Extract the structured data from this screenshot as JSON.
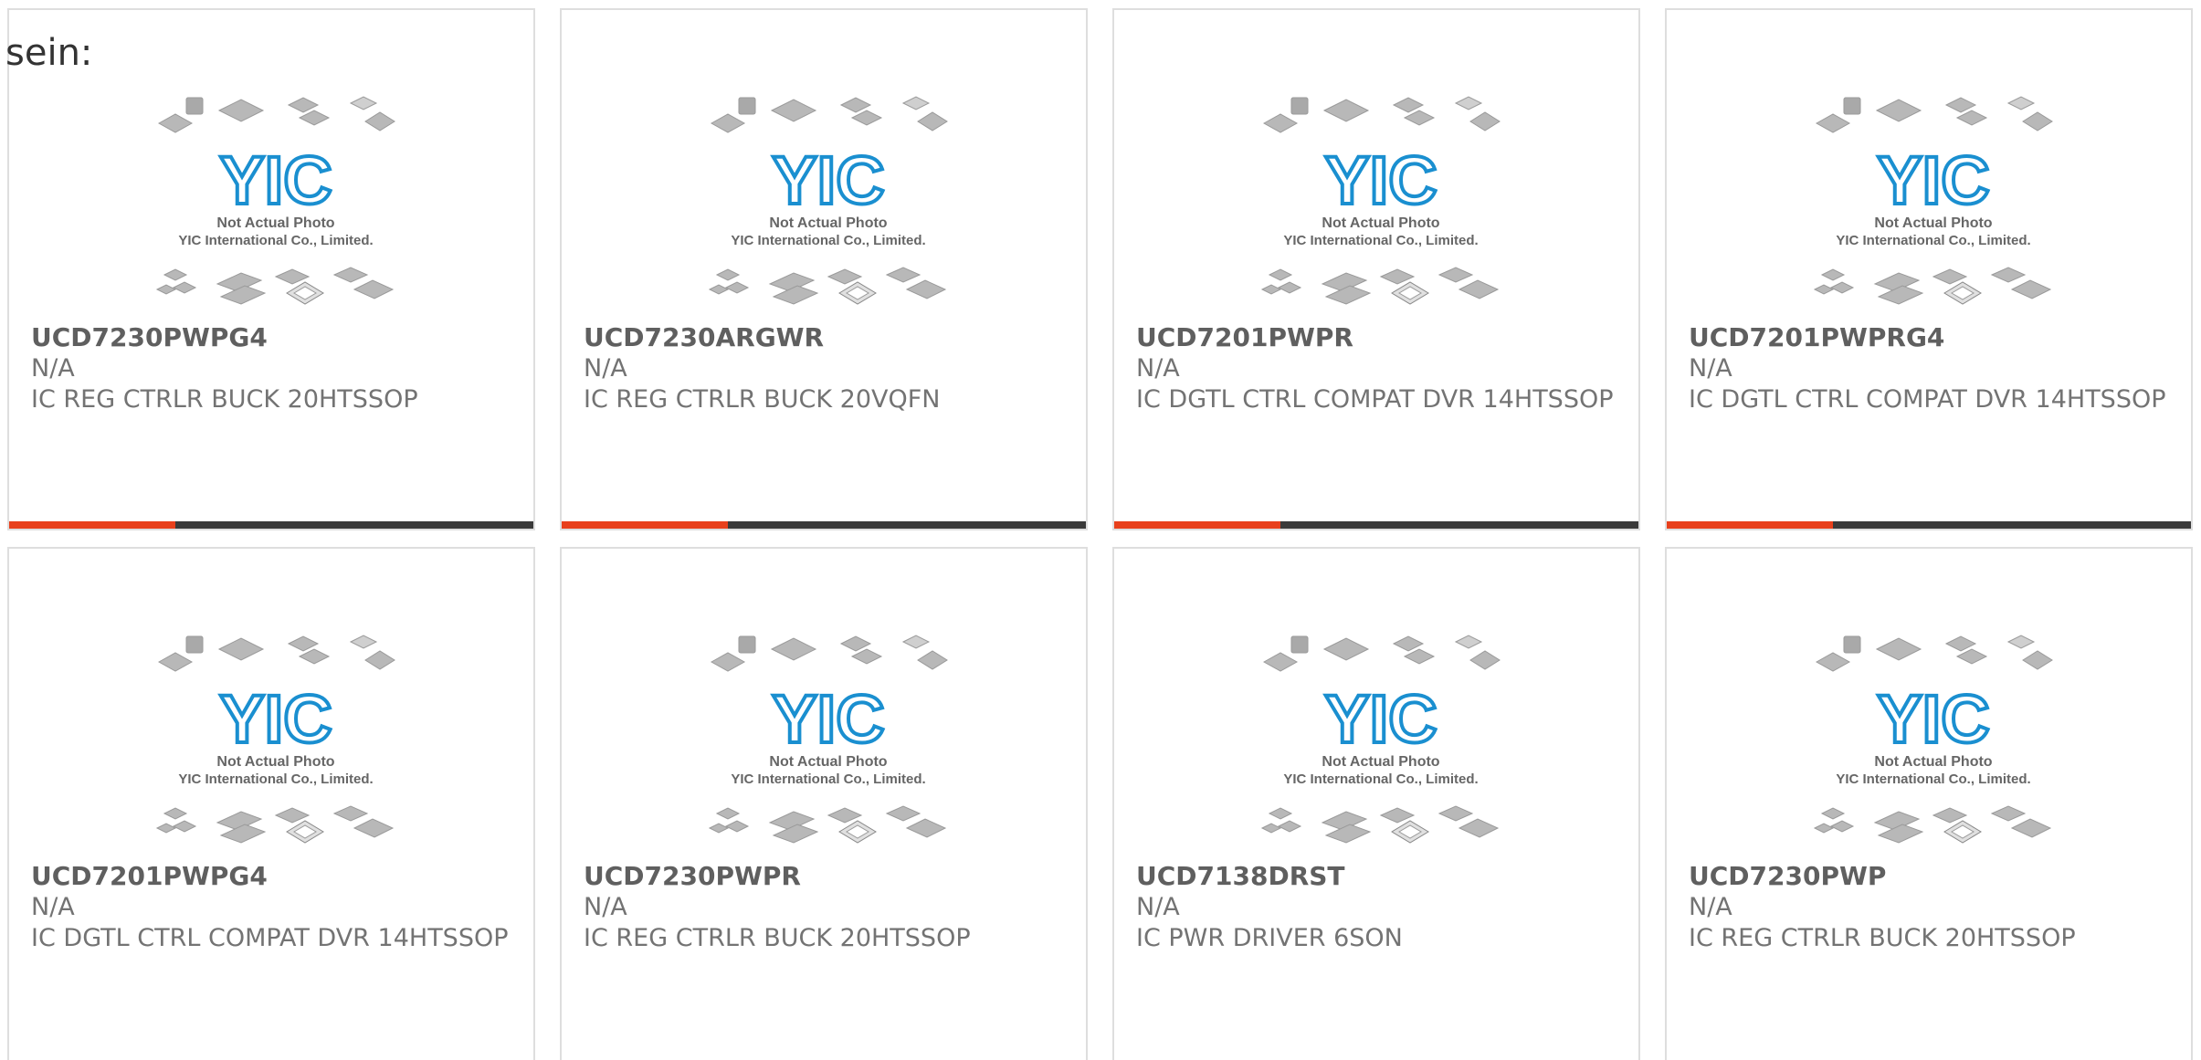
{
  "intro_text": "sein:",
  "placeholder": {
    "line1": "Not Actual Photo",
    "line2": "YIC International Co., Limited.",
    "logo": "YIC"
  },
  "colors": {
    "accent": "#e8401c",
    "bar": "#3a3a3a",
    "logo_blue": "#1a8fd0"
  },
  "products": [
    {
      "part": "UCD7230PWPG4",
      "manufacturer": "N/A",
      "description": "IC REG CTRLR BUCK 20HTSSOP"
    },
    {
      "part": "UCD7230ARGWR",
      "manufacturer": "N/A",
      "description": "IC REG CTRLR BUCK 20VQFN"
    },
    {
      "part": "UCD7201PWPR",
      "manufacturer": "N/A",
      "description": "IC DGTL CTRL COMPAT DVR 14HTSSOP"
    },
    {
      "part": "UCD7201PWPRG4",
      "manufacturer": "N/A",
      "description": "IC DGTL CTRL COMPAT DVR 14HTSSOP"
    },
    {
      "part": "UCD7201PWPG4",
      "manufacturer": "N/A",
      "description": "IC DGTL CTRL COMPAT DVR 14HTSSOP"
    },
    {
      "part": "UCD7230PWPR",
      "manufacturer": "N/A",
      "description": "IC REG CTRLR BUCK 20HTSSOP"
    },
    {
      "part": "UCD7138DRST",
      "manufacturer": "N/A",
      "description": "IC PWR DRIVER 6SON"
    },
    {
      "part": "UCD7230PWP",
      "manufacturer": "N/A",
      "description": "IC REG CTRLR BUCK 20HTSSOP"
    }
  ]
}
